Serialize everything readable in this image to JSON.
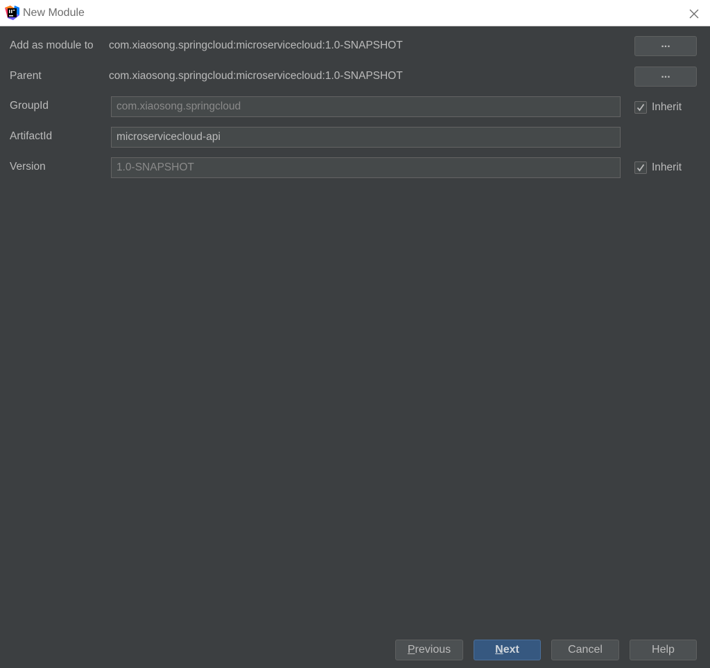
{
  "window": {
    "title": "New Module",
    "icon": "intellij-idea-icon"
  },
  "form": {
    "add_as_module_to": {
      "label": "Add as module to",
      "value": "com.xiaosong.springcloud:microservicecloud:1.0-SNAPSHOT",
      "button_label": "..."
    },
    "parent": {
      "label": "Parent",
      "value": "com.xiaosong.springcloud:microservicecloud:1.0-SNAPSHOT",
      "button_label": "..."
    },
    "group_id": {
      "label": "GroupId",
      "value": "com.xiaosong.springcloud",
      "inherit_label": "Inherit",
      "inherit_checked": true
    },
    "artifact_id": {
      "label": "ArtifactId",
      "value": "microservicecloud-api"
    },
    "version": {
      "label": "Version",
      "value": "1.0-SNAPSHOT",
      "inherit_label": "Inherit",
      "inherit_checked": true
    }
  },
  "footer": {
    "previous": {
      "mnemonic": "P",
      "rest": "revious"
    },
    "next": {
      "mnemonic": "N",
      "rest": "ext"
    },
    "cancel": "Cancel",
    "help": "Help"
  },
  "colors": {
    "background": "#3c3f41",
    "primary_button": "#365880",
    "text": "#bbbbbb"
  }
}
